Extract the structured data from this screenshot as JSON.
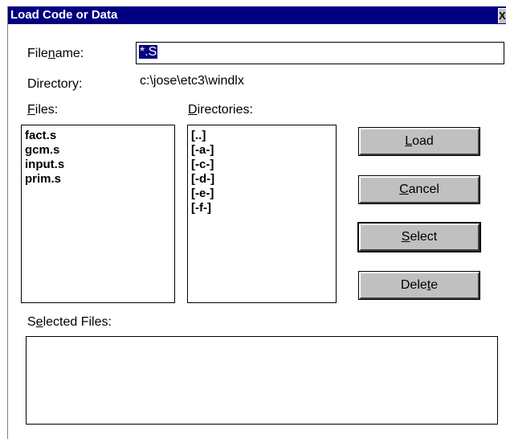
{
  "window": {
    "title": "Load Code or Data",
    "close_glyph": "X"
  },
  "filename": {
    "label_pre": "File",
    "label_u": "n",
    "label_post": "ame:",
    "value": "*.S"
  },
  "directory": {
    "label": "Directory:",
    "value": "c:\\jose\\etc3\\windlx"
  },
  "files": {
    "label_u": "F",
    "label_post": "iles:",
    "items": [
      "fact.s",
      "gcm.s",
      "input.s",
      "prim.s"
    ]
  },
  "directories": {
    "label_u": "D",
    "label_post": "irectories:",
    "items": [
      "[..]",
      "[-a-]",
      "[-c-]",
      "[-d-]",
      "[-e-]",
      "[-f-]"
    ]
  },
  "buttons": {
    "load": {
      "pre": "",
      "u": "L",
      "post": "oad"
    },
    "cancel": {
      "pre": "",
      "u": "C",
      "post": "ancel"
    },
    "select": {
      "pre": "",
      "u": "S",
      "post": "elect"
    },
    "delete": {
      "pre": "Dele",
      "u": "t",
      "post": "e"
    }
  },
  "selected_files": {
    "label_pre": "S",
    "label_u": "e",
    "label_post": "lected Files:",
    "items": []
  }
}
